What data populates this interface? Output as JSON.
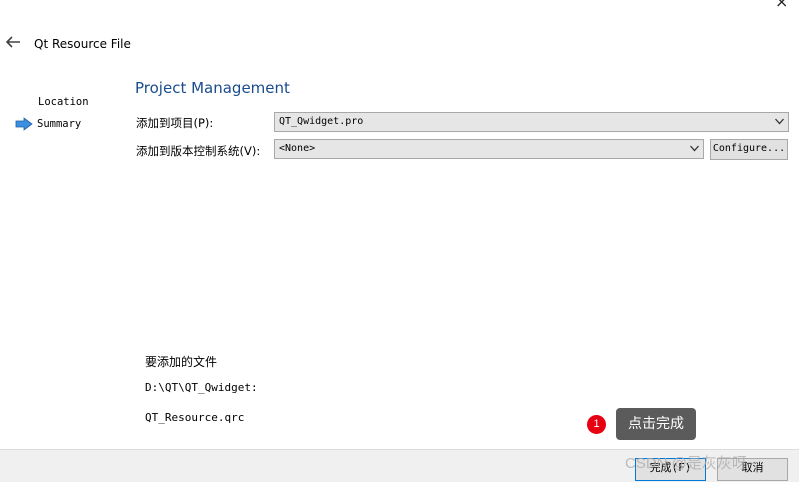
{
  "window": {
    "close_glyph": "×"
  },
  "wizard": {
    "title": "Qt Resource File",
    "back_icon": "back-arrow-icon"
  },
  "steps": [
    {
      "label": "Location",
      "current": false
    },
    {
      "label": "Summary",
      "current": true
    }
  ],
  "page": {
    "title": "Project Management",
    "add_to_project_label": "添加到项目(P):",
    "add_to_project_value": "QT_Qwidget.pro",
    "add_to_vcs_label": "添加到版本控制系统(V):",
    "add_to_vcs_value": "<None>",
    "configure_label": "Configure..."
  },
  "files": {
    "heading": "要添加的文件",
    "path": "D:\\QT\\QT_Qwidget:",
    "name": "QT_Resource.qrc"
  },
  "footer": {
    "finish_label": "完成(F)",
    "cancel_label": "取消"
  },
  "annotation": {
    "number": "1",
    "text": "点击完成"
  },
  "watermark": "CSDN @是灰灰呀~",
  "colors": {
    "title_blue": "#1a4c8c",
    "step_arrow": "#3b8fe0",
    "callout_red": "#e60012",
    "finish_border": "#0078d7"
  }
}
